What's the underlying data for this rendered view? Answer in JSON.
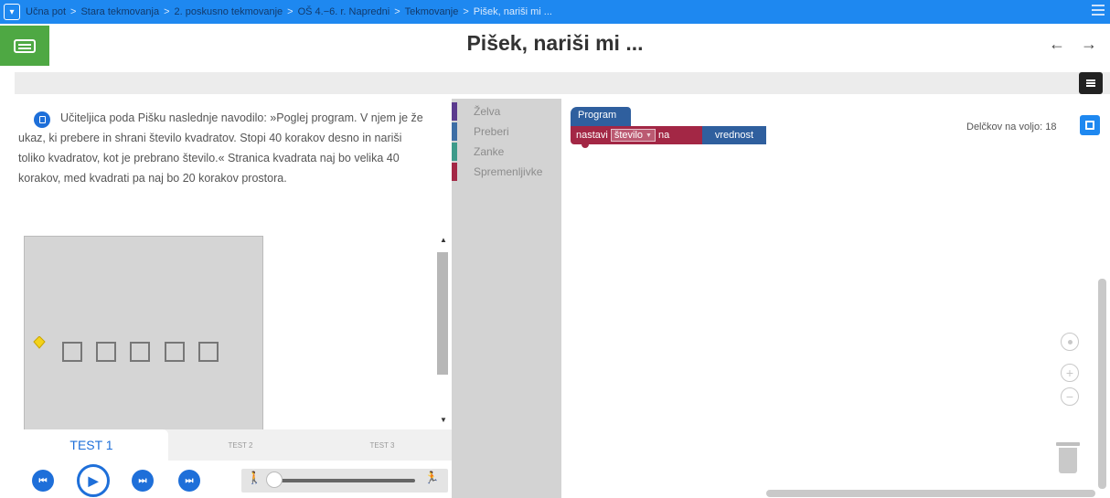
{
  "breadcrumb": {
    "items": [
      "Učna pot",
      "Stara tekmovanja",
      "2. poskusno tekmovanje",
      "OŠ 4.−6. r. Napredni",
      "Tekmovanje",
      "Pišek, nariši mi ..."
    ],
    "separator": ">"
  },
  "header": {
    "title": "Pišek, nariši mi ...",
    "nav_arrows": "← →"
  },
  "instructions": {
    "text": "Učiteljica poda Pišku naslednje navodilo: »Poglej program. V njem je že ukaz, ki prebere in shrani število kvadratov. Stopi 40 korakov desno in nariši toliko kvadratov, kot je prebrano število.« Stranica kvadrata naj bo velika 40 korakov, med kvadrati pa naj bo 20 korakov prostora."
  },
  "tests": {
    "tabs": [
      {
        "label": "TEST 1",
        "active": true
      },
      {
        "label": "TEST 2",
        "active": false
      },
      {
        "label": "TEST 3",
        "active": false
      }
    ]
  },
  "toolbox": {
    "categories": [
      {
        "label": "Želva",
        "color": "#5b3a8e"
      },
      {
        "label": "Preberi",
        "color": "#3d6ea5"
      },
      {
        "label": "Zanke",
        "color": "#3d9a8a"
      },
      {
        "label": "Spremenljivke",
        "color": "#a32745"
      }
    ]
  },
  "workspace": {
    "program_block": "Program",
    "set_block": {
      "prefix": "nastavi",
      "variable": "število",
      "middle": "na",
      "value": "vrednost"
    },
    "blocks_left": "Delčkov na voljo: 18"
  },
  "icons": {
    "playback": [
      "skip-back-icon",
      "play-icon",
      "step-icon",
      "skip-forward-icon"
    ],
    "speed": [
      "slow-walker-icon",
      "fast-walker-icon"
    ]
  },
  "colors": {
    "accent": "#1e88f0",
    "keyboard_button": "#4ea843",
    "variable_block": "#a32745",
    "program_block": "#2f5f9e"
  }
}
